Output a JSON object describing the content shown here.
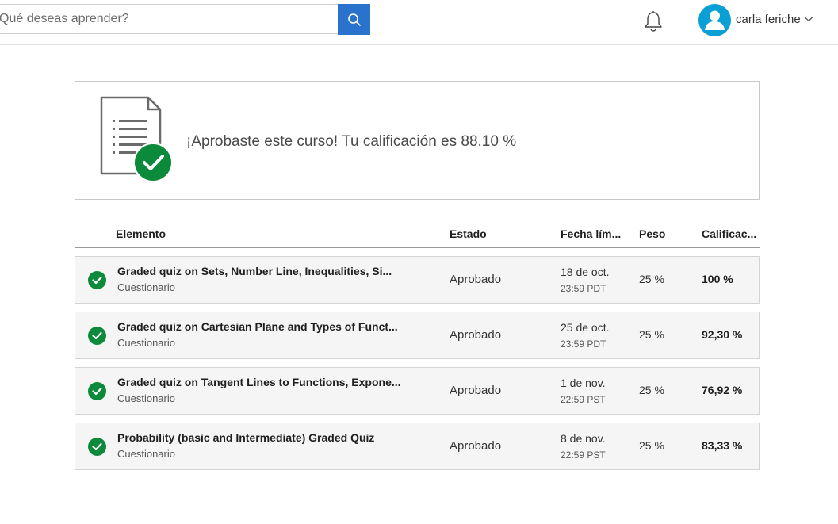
{
  "header": {
    "search_placeholder": "Qué deseas aprender?",
    "user_name": "carla feriche"
  },
  "banner": {
    "message": "¡Aprobaste este curso! Tu calificación es 88.10 %"
  },
  "table": {
    "headers": {
      "item": "Elemento",
      "status": "Estado",
      "due": "Fecha lím...",
      "weight": "Peso",
      "grade": "Calificac..."
    },
    "rows": [
      {
        "title": "Graded quiz on Sets, Number Line, Inequalities, Si...",
        "type": "Cuestionario",
        "status": "Aprobado",
        "due_date": "18 de oct.",
        "due_time": "23:59 PDT",
        "weight": "25 %",
        "grade": "100 %"
      },
      {
        "title": "Graded quiz on Cartesian Plane and Types of Funct...",
        "type": "Cuestionario",
        "status": "Aprobado",
        "due_date": "25 de oct.",
        "due_time": "23:59 PDT",
        "weight": "25 %",
        "grade": "92,30 %"
      },
      {
        "title": "Graded quiz on Tangent Lines to Functions, Expone...",
        "type": "Cuestionario",
        "status": "Aprobado",
        "due_date": "1 de nov.",
        "due_time": "22:59 PST",
        "weight": "25 %",
        "grade": "76,92 %"
      },
      {
        "title": "Probability (basic and Intermediate) Graded Quiz",
        "type": "Cuestionario",
        "status": "Aprobado",
        "due_date": "8 de nov.",
        "due_time": "22:59 PST",
        "weight": "25 %",
        "grade": "83,33 %"
      }
    ]
  },
  "colors": {
    "accent": "#2a73cc",
    "success": "#0a8a3a",
    "avatar": "#0aa0d6"
  },
  "icons": [
    "search-icon",
    "bell-icon",
    "user-icon",
    "chevron-down-icon",
    "document-check-icon",
    "check-icon"
  ]
}
